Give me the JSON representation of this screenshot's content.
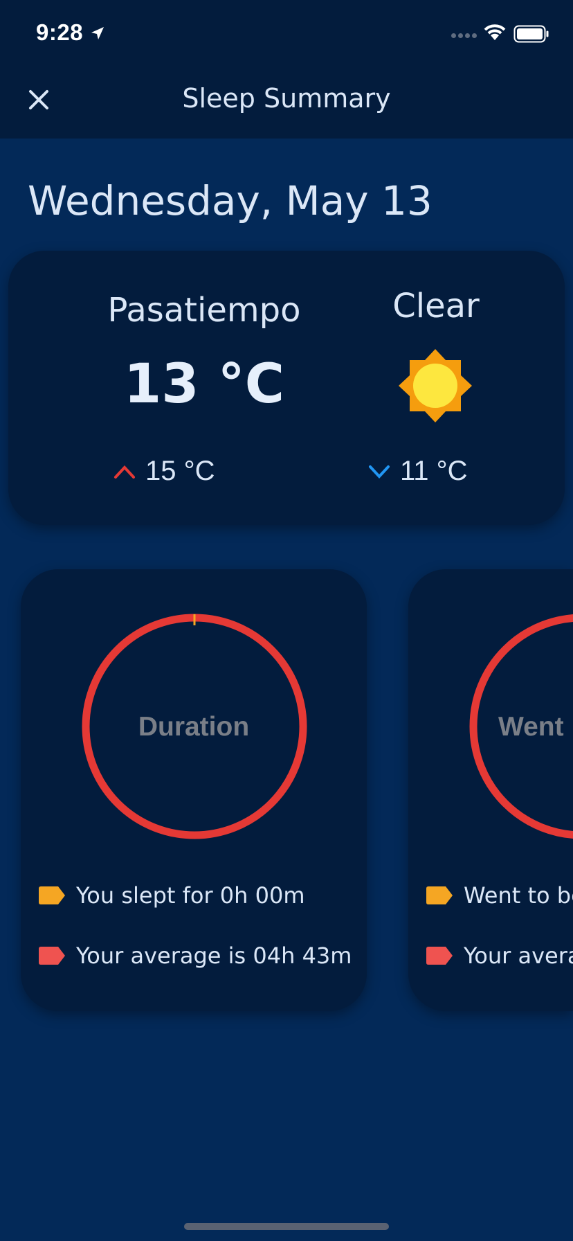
{
  "status_bar": {
    "time": "9:28"
  },
  "nav": {
    "title": "Sleep Summary"
  },
  "date": "Wednesday, May 13",
  "weather": {
    "city": "Pasatiempo",
    "temperature": "13 °C",
    "condition": "Clear",
    "high": "15 °C",
    "low": "11 °C",
    "high_color": "#e53935",
    "low_color": "#2196f3"
  },
  "cards": [
    {
      "label": "Duration",
      "legend": [
        {
          "text": "You slept for 0h 00m",
          "color": "#f5a623"
        },
        {
          "text": "Your average is 04h 43m",
          "color": "#ef5350"
        }
      ]
    },
    {
      "label": "Went",
      "legend": [
        {
          "text": "Went to be",
          "color": "#f5a623"
        },
        {
          "text": "Your avera",
          "color": "#ef5350"
        }
      ]
    }
  ],
  "colors": {
    "background": "#032958",
    "card": "#031c3d",
    "ring": "#e53935",
    "accent": "#f5a623"
  },
  "icons": [
    "location-arrow-icon",
    "wifi-icon",
    "battery-icon",
    "close-icon",
    "sun-icon",
    "chevron-up-icon",
    "chevron-down-icon"
  ]
}
